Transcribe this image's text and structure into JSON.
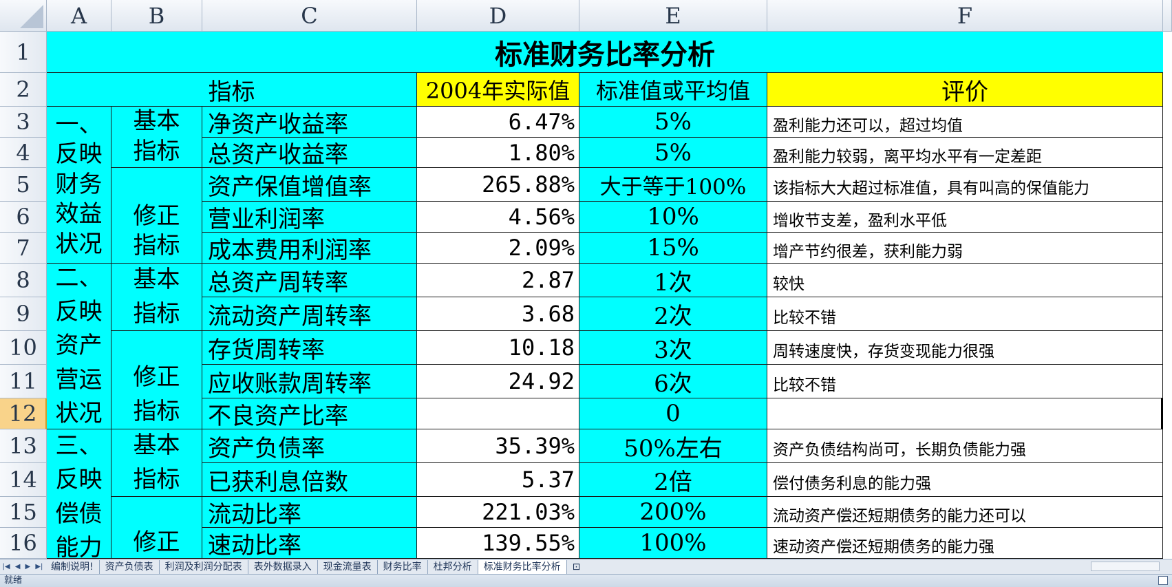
{
  "columns": [
    "A",
    "B",
    "C",
    "D",
    "E",
    "F"
  ],
  "rows": [
    "1",
    "2",
    "3",
    "4",
    "5",
    "6",
    "7",
    "8",
    "9",
    "10",
    "11",
    "12",
    "13",
    "14",
    "15",
    "16"
  ],
  "title": "标准财务比率分析",
  "header": {
    "indicator": "指标",
    "actual": "2004年实际值",
    "standard": "标准值或平均值",
    "evaluation": "评价"
  },
  "groups": {
    "g1": [
      "一、",
      "反映",
      "财务",
      "效益",
      "状况"
    ],
    "g2": [
      "二、",
      "反映",
      "资产",
      "营运",
      "状况"
    ],
    "g3": [
      "三、",
      "反映",
      "偿债",
      "能力"
    ]
  },
  "subgroups": {
    "basic": "基本",
    "index": "指标",
    "modify": "修正"
  },
  "table": [
    {
      "name": "净资产收益率",
      "actual": "6.47%",
      "standard": "5%",
      "eval": "盈利能力还可以，超过均值"
    },
    {
      "name": "总资产收益率",
      "actual": "1.80%",
      "standard": "5%",
      "eval": "盈利能力较弱，离平均水平有一定差距"
    },
    {
      "name": "资产保值增值率",
      "actual": "265.88%",
      "standard": "大于等于100%",
      "eval": "该指标大大超过标准值，具有叫高的保值能力"
    },
    {
      "name": "营业利润率",
      "actual": "4.56%",
      "standard": "10%",
      "eval": "增收节支差，盈利水平低"
    },
    {
      "name": "成本费用利润率",
      "actual": "2.09%",
      "standard": "15%",
      "eval": "增产节约很差，获利能力弱"
    },
    {
      "name": "总资产周转率",
      "actual": "2.87",
      "standard": "1次",
      "eval": "较快"
    },
    {
      "name": "流动资产周转率",
      "actual": "3.68",
      "standard": "2次",
      "eval": "比较不错"
    },
    {
      "name": "存货周转率",
      "actual": "10.18",
      "standard": "3次",
      "eval": "周转速度快，存货变现能力很强"
    },
    {
      "name": "应收账款周转率",
      "actual": "24.92",
      "standard": "6次",
      "eval": "比较不错"
    },
    {
      "name": "不良资产比率",
      "actual": "",
      "standard": "0",
      "eval": ""
    },
    {
      "name": "资产负债率",
      "actual": "35.39%",
      "standard": "50%左右",
      "eval": "资产负债结构尚可，长期负债能力强"
    },
    {
      "name": "已获利息倍数",
      "actual": "5.37",
      "standard": "2倍",
      "eval": "偿付债务利息的能力强"
    },
    {
      "name": "流动比率",
      "actual": "221.03%",
      "standard": "200%",
      "eval": "流动资产偿还短期债务的能力还可以"
    },
    {
      "name": "速动比率",
      "actual": "139.55%",
      "standard": "100%",
      "eval": "速动资产偿还短期债务的能力强"
    }
  ],
  "tabs": [
    "编制说明!",
    "资产负债表",
    "利润及利润分配表",
    "表外数据录入",
    "现金流量表",
    "财务比率",
    "杜邦分析",
    "标准财务比率分析"
  ],
  "active_tab": "标准财务比率分析",
  "status": "就绪",
  "colors": {
    "cyan": "#00ffff",
    "yellow": "#ffff00",
    "active_row": "#f9d38a"
  }
}
